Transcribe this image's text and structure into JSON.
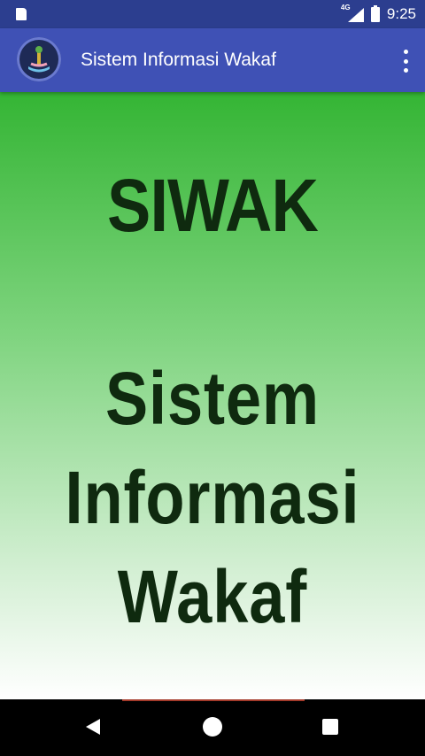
{
  "status_bar": {
    "network_type": "4G",
    "time": "9:25"
  },
  "toolbar": {
    "title": "Sistem Informasi Wakaf",
    "logo_icon": "waqf-hand-logo-icon",
    "menu_icon": "overflow-menu-icon"
  },
  "main": {
    "heading": "SIWAK",
    "subtitle_lines": [
      "Sistem",
      "Informasi",
      "Wakaf"
    ]
  },
  "nav_bar": {
    "back_icon": "back-icon",
    "home_icon": "home-icon",
    "recent_icon": "recent-apps-icon"
  },
  "colors": {
    "status_bar": "#2c3e8f",
    "toolbar": "#3f51b5",
    "gradient_top": "#34b534",
    "gradient_bottom": "#ffffff",
    "text_dark_green": "#0f2a0f"
  }
}
